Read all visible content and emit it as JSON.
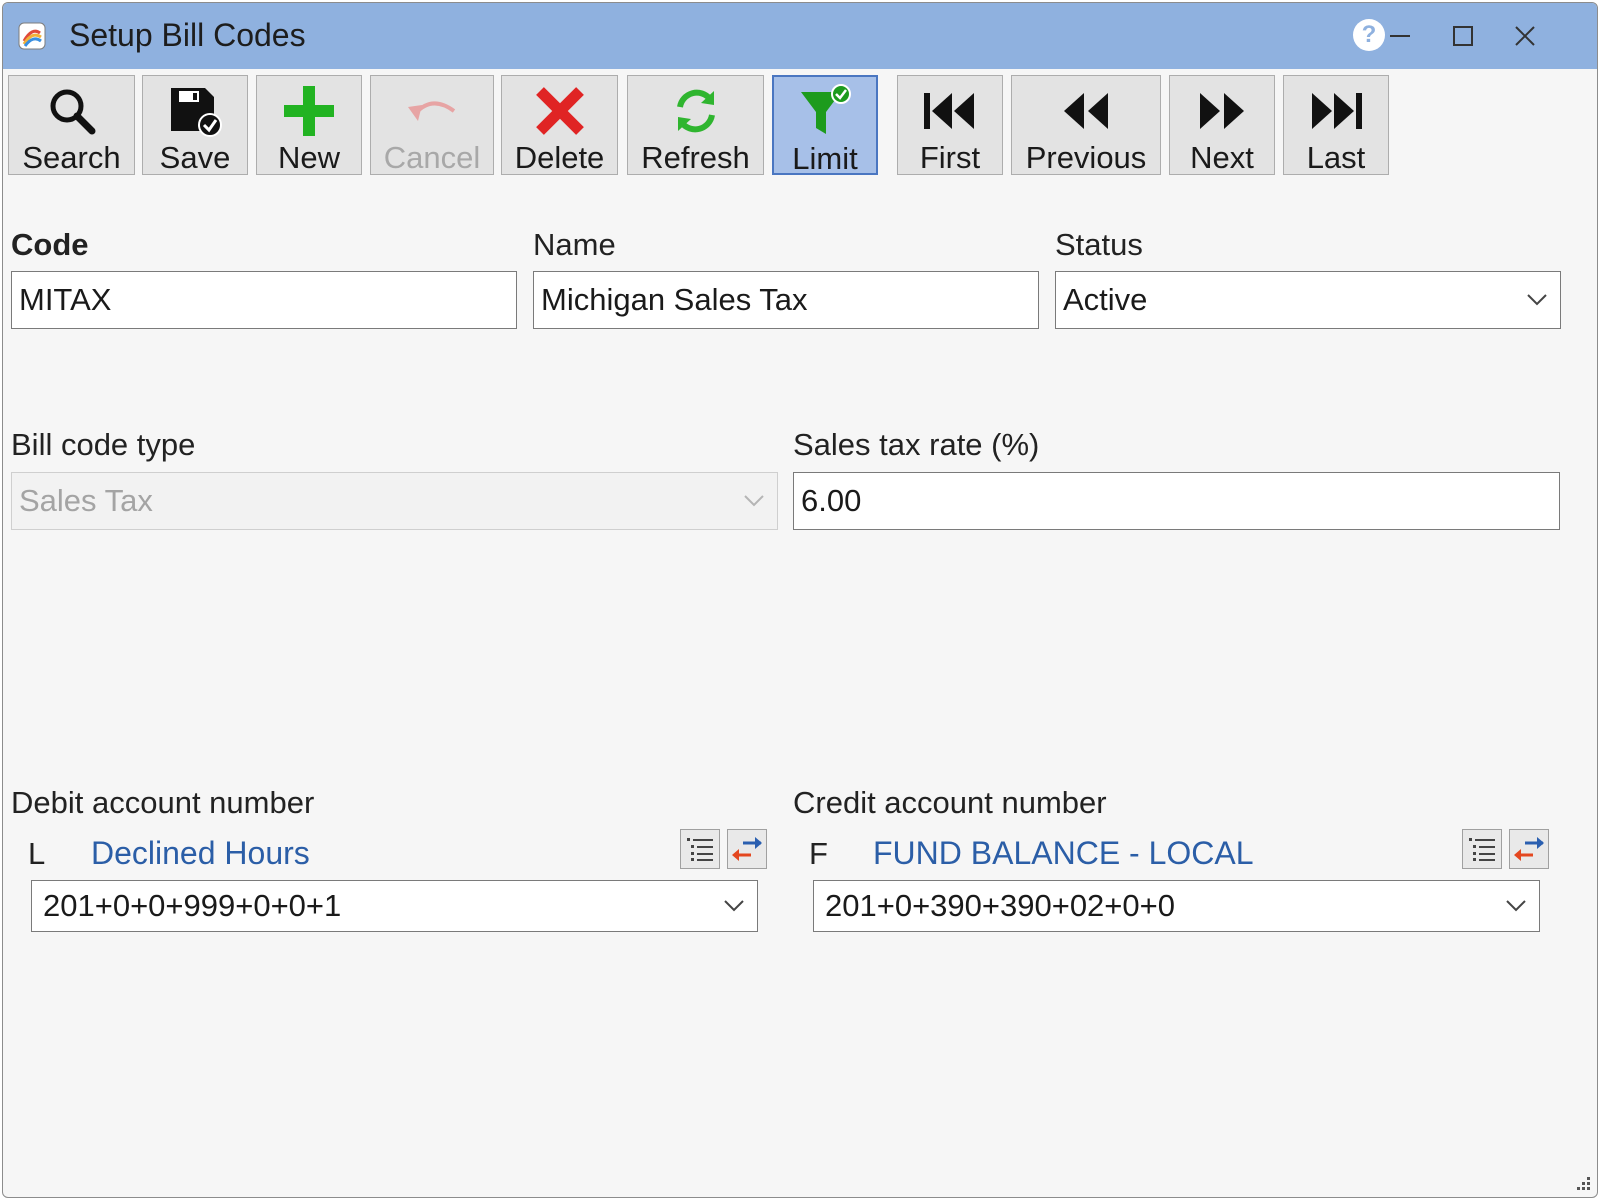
{
  "window": {
    "title": "Setup Bill Codes",
    "help_label": "?"
  },
  "toolbar": {
    "search": "Search",
    "save": "Save",
    "new": "New",
    "cancel": "Cancel",
    "delete": "Delete",
    "refresh": "Refresh",
    "limit": "Limit",
    "first": "First",
    "previous": "Previous",
    "next": "Next",
    "last": "Last"
  },
  "form": {
    "code_label": "Code",
    "code_value": "MITAX",
    "name_label": "Name",
    "name_value": "Michigan Sales Tax",
    "status_label": "Status",
    "status_value": "Active",
    "bill_code_type_label": "Bill code type",
    "bill_code_type_value": "Sales Tax",
    "sales_tax_rate_label": "Sales tax rate (%)",
    "sales_tax_rate_value": "6.00"
  },
  "debit": {
    "label": "Debit account number",
    "prefix": "L",
    "description": "Declined Hours",
    "account": "201+0+0+999+0+0+1"
  },
  "credit": {
    "label": "Credit account number",
    "prefix": "F",
    "description": "FUND BALANCE - LOCAL",
    "account": "201+0+390+390+02+0+0"
  },
  "colors": {
    "titlebar": "#8fb1df",
    "link_text": "#2b5ea7",
    "active_button": "#a7c0e8"
  }
}
